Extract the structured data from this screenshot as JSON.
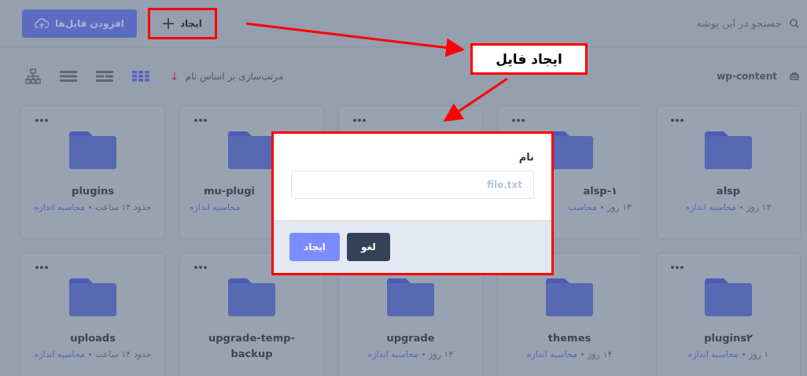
{
  "topbar": {
    "search": {
      "placeholder": "جستجو در این پوشه"
    },
    "upload_button": "افزودن فایل‌ها",
    "create_button": {
      "label": "ایجاد",
      "highlighted": true
    }
  },
  "toolbar": {
    "path": "wp-content",
    "sort": {
      "label": "مرتب‌سازی بر اساس نام",
      "arrow": "↓"
    },
    "views": [
      {
        "kind": "grid",
        "selected": true
      },
      {
        "kind": "details",
        "selected": false
      },
      {
        "kind": "list",
        "selected": false
      },
      {
        "kind": "tree",
        "selected": false
      }
    ]
  },
  "folders": [
    {
      "kind": "full",
      "name": "alsp",
      "age": "۱۳ روز",
      "action": "محاسبه اندازه"
    },
    {
      "kind": "leftcut",
      "name": "alsp-۱",
      "age": "۱۳ روز",
      "action": "محاسب"
    },
    {
      "kind": "covered"
    },
    {
      "kind": "rightcut",
      "name": "mu-plugi",
      "action": "محاسبه اندازه"
    },
    {
      "kind": "full",
      "name": "plugins",
      "age": "حدود ۱۴ ساعت",
      "action": "محاسبه اندازه"
    },
    {
      "kind": "full",
      "name": "plugins۲",
      "age": "۱ روز",
      "action": "محاسبه اندازه"
    },
    {
      "kind": "full",
      "name": "themes",
      "age": "۱۴ روز",
      "action": "محاسبه اندازه"
    },
    {
      "kind": "full",
      "name": "upgrade",
      "age": "۱۴ روز",
      "action": "محاسبه اندازه"
    },
    {
      "kind": "full",
      "name": "upgrade-temp-backup"
    },
    {
      "kind": "full",
      "name": "uploads",
      "age": "حدود ۱۴ ساعت",
      "action": "محاسبه اندازه"
    }
  ],
  "dialog": {
    "label": "نام",
    "placeholder": "file.txt",
    "buttons": [
      {
        "label": "لغو",
        "kind": "secondary"
      },
      {
        "label": "ایجاد",
        "kind": "primary"
      }
    ]
  },
  "callout": "ایجاد فایل"
}
